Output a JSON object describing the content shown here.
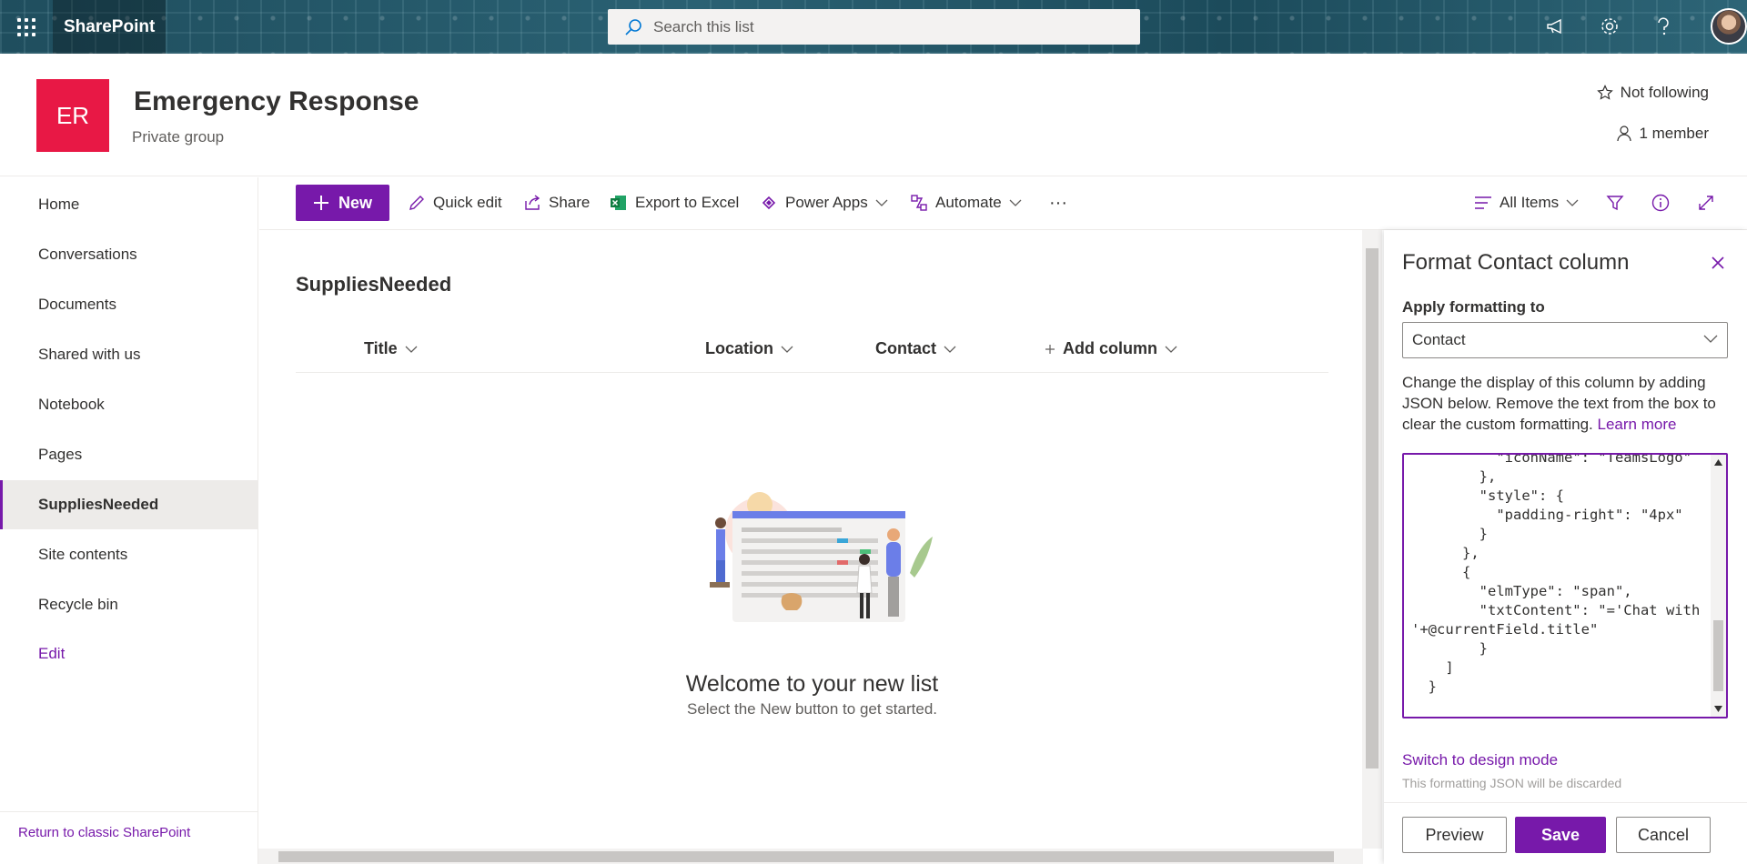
{
  "suitebar": {
    "app_name": "SharePoint",
    "search_placeholder": "Search this list"
  },
  "site": {
    "logo_text": "ER",
    "title": "Emergency Response",
    "subtitle": "Private group",
    "follow_label": "Not following",
    "members_label": "1 member"
  },
  "nav": {
    "items": [
      {
        "label": "Home"
      },
      {
        "label": "Conversations"
      },
      {
        "label": "Documents"
      },
      {
        "label": "Shared with us"
      },
      {
        "label": "Notebook"
      },
      {
        "label": "Pages"
      },
      {
        "label": "SuppliesNeeded",
        "selected": true
      },
      {
        "label": "Site contents"
      },
      {
        "label": "Recycle bin"
      }
    ],
    "edit_label": "Edit",
    "classic_link": "Return to classic SharePoint"
  },
  "commandbar": {
    "new_label": "New",
    "quick_edit": "Quick edit",
    "share": "Share",
    "export": "Export to Excel",
    "power_apps": "Power Apps",
    "automate": "Automate",
    "more": "···",
    "view": "All Items"
  },
  "list": {
    "title": "SuppliesNeeded",
    "columns": [
      "Title",
      "Location",
      "Contact",
      "Add column"
    ],
    "empty_title": "Welcome to your new list",
    "empty_subtitle": "Select the New button to get started."
  },
  "pane": {
    "title": "Format Contact column",
    "apply_label": "Apply formatting to",
    "apply_value": "Contact",
    "description": "Change the display of this column by adding JSON below. Remove the text from the box to clear the custom formatting.",
    "learn_more": "Learn more",
    "json_text": "          \"iconName\": \"TeamsLogo\"\n        },\n        \"style\": {\n          \"padding-right\": \"4px\"\n        }\n      },\n      {\n        \"elmType\": \"span\",\n        \"txtContent\": \"='Chat with '+@currentField.title\"\n        }\n    ]\n  }",
    "switch_link": "Switch to design mode",
    "switch_note": "This formatting JSON will be discarded",
    "preview": "Preview",
    "save": "Save",
    "cancel": "Cancel"
  },
  "colors": {
    "accent": "#7719aa",
    "site_logo": "#e81845",
    "suitebar": "#1b4a5a"
  }
}
